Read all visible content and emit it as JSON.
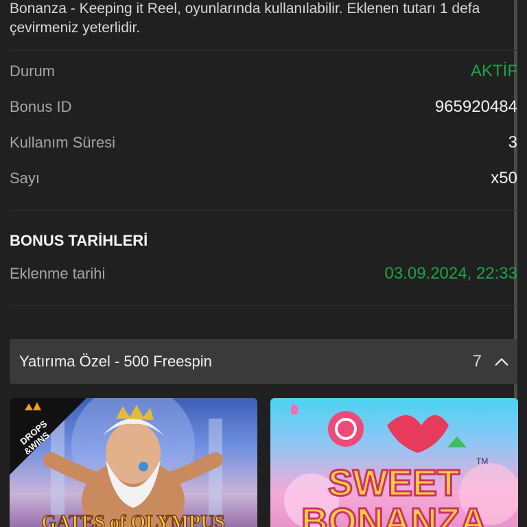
{
  "description": "Bonanza - Keeping it Reel, oyunlarında kullanılabilir. Eklenen tutarı 1 defa çevirmeniz yeterlidir.",
  "details": [
    {
      "label": "Durum",
      "value": "AKTİF",
      "status": "active"
    },
    {
      "label": "Bonus ID",
      "value": "965920484"
    },
    {
      "label": "Kullanım Süresi",
      "value": "3"
    },
    {
      "label": "Sayı",
      "value": "x50"
    }
  ],
  "dates_section": {
    "title": "BONUS TARİHLERİ",
    "added_label": "Eklenme tarihi",
    "added_value": "03.09.2024, 22:33"
  },
  "accordion": {
    "title": "Yatırıma Özel - 500 Freespin",
    "count": "7",
    "icon": "chevron-up-icon"
  },
  "games": [
    {
      "title": "GATES of OLYMPUS",
      "badge": "DROPS & WINS"
    },
    {
      "title": "SWEET BONANZA"
    }
  ],
  "colors": {
    "background": "#202020",
    "accent_green": "#1ea446",
    "accordion_bg": "#3a3a3a"
  }
}
